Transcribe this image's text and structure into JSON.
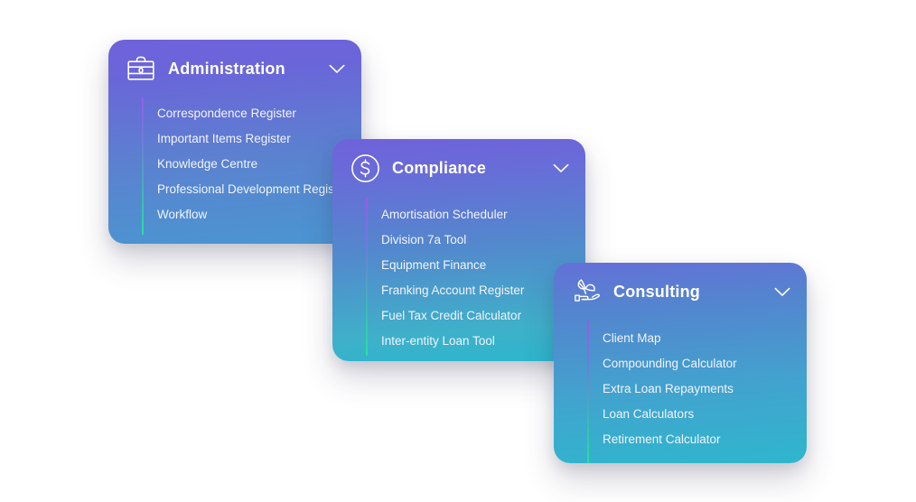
{
  "page": {
    "background_color": "#ffffff",
    "accent_rail_top_color": "#9a5ce6",
    "accent_rail_bottom_color": "#25e39b"
  },
  "cards": [
    {
      "id": "administration",
      "title": "Administration",
      "icon": "briefcase-icon",
      "expand_icon": "chevron-down-icon",
      "gradient_from": "#6f62da",
      "gradient_to": "#4a96d1",
      "items": [
        {
          "label": "Correspondence Register"
        },
        {
          "label": "Important Items Register"
        },
        {
          "label": "Knowledge Centre"
        },
        {
          "label": "Professional Development Register"
        },
        {
          "label": "Workflow"
        }
      ]
    },
    {
      "id": "compliance",
      "title": "Compliance",
      "icon": "dollar-circle-icon",
      "expand_icon": "chevron-down-icon",
      "gradient_from": "#6f62da",
      "gradient_to": "#2ab7cd",
      "items": [
        {
          "label": "Amortisation Scheduler"
        },
        {
          "label": "Division 7a Tool"
        },
        {
          "label": "Equipment Finance"
        },
        {
          "label": "Franking Account Register"
        },
        {
          "label": "Fuel Tax Credit Calculator"
        },
        {
          "label": "Inter-entity Loan Tool"
        }
      ]
    },
    {
      "id": "consulting",
      "title": "Consulting",
      "icon": "hand-holding-plant-icon",
      "expand_icon": "chevron-down-icon",
      "gradient_from": "#6470d8",
      "gradient_to": "#2fb6cd",
      "items": [
        {
          "label": "Client Map"
        },
        {
          "label": "Compounding Calculator"
        },
        {
          "label": "Extra Loan Repayments"
        },
        {
          "label": "Loan Calculators"
        },
        {
          "label": "Retirement Calculator"
        }
      ]
    }
  ]
}
